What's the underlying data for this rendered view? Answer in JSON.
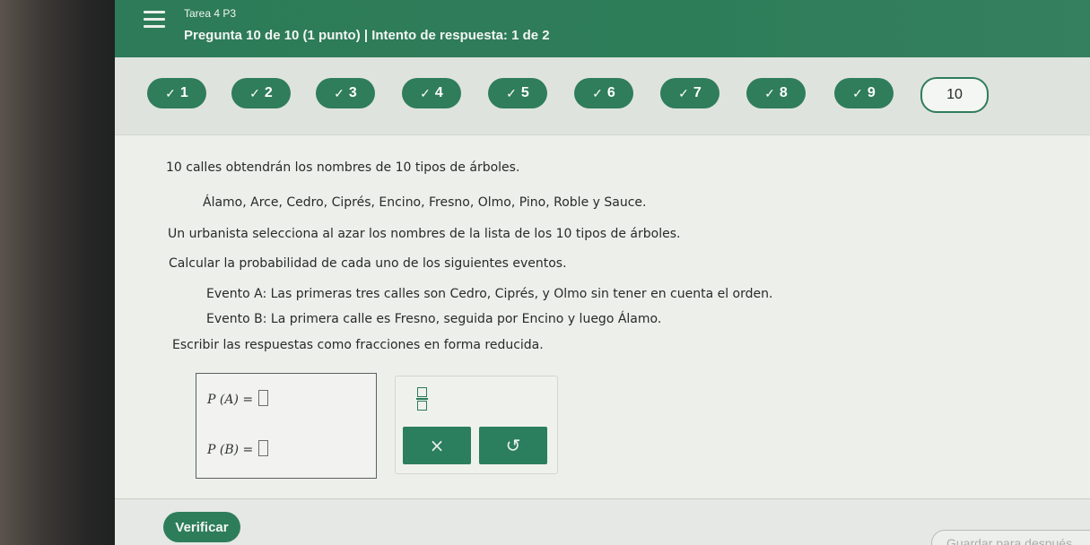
{
  "header": {
    "assignment": "Tarea 4 P3",
    "question_info": "Pregunta 10 de 10 (1 punto)  |  Intento de respuesta: 1 de 2"
  },
  "question_nav": {
    "items": [
      {
        "label": "1",
        "status": "answered"
      },
      {
        "label": "2",
        "status": "answered"
      },
      {
        "label": "3",
        "status": "answered"
      },
      {
        "label": "4",
        "status": "answered"
      },
      {
        "label": "5",
        "status": "answered"
      },
      {
        "label": "6",
        "status": "answered"
      },
      {
        "label": "7",
        "status": "answered"
      },
      {
        "label": "8",
        "status": "answered"
      },
      {
        "label": "9",
        "status": "answered"
      },
      {
        "label": "10",
        "status": "current"
      }
    ],
    "check_symbol": "✓"
  },
  "question": {
    "line1": "10 calles obtendrán los nombres de 10 tipos de árboles.",
    "line2": "Álamo, Arce, Cedro, Ciprés, Encino, Fresno, Olmo, Pino, Roble y Sauce.",
    "line3": "Un urbanista selecciona al azar los nombres de la lista de los 10 tipos de árboles.",
    "line4": "Calcular la probabilidad de cada uno de los siguientes eventos.",
    "event_a": "Evento A: Las primeras tres calles son Cedro, Ciprés, y Olmo sin tener en cuenta el orden.",
    "event_b": "Evento B: La primera calle es Fresno, seguida por Encino y luego Álamo.",
    "instruction": "Escribir las respuestas como fracciones en forma reducida."
  },
  "answers": {
    "pa_label": "P (A)  =",
    "pb_label": "P (B)  ="
  },
  "keypad": {
    "clear_symbol": "×",
    "undo_symbol": "↺"
  },
  "footer": {
    "verify_label": "Verificar",
    "save_label": "Guardar para después"
  },
  "colors": {
    "accent": "#2e7d5a",
    "background": "#edefeb"
  }
}
